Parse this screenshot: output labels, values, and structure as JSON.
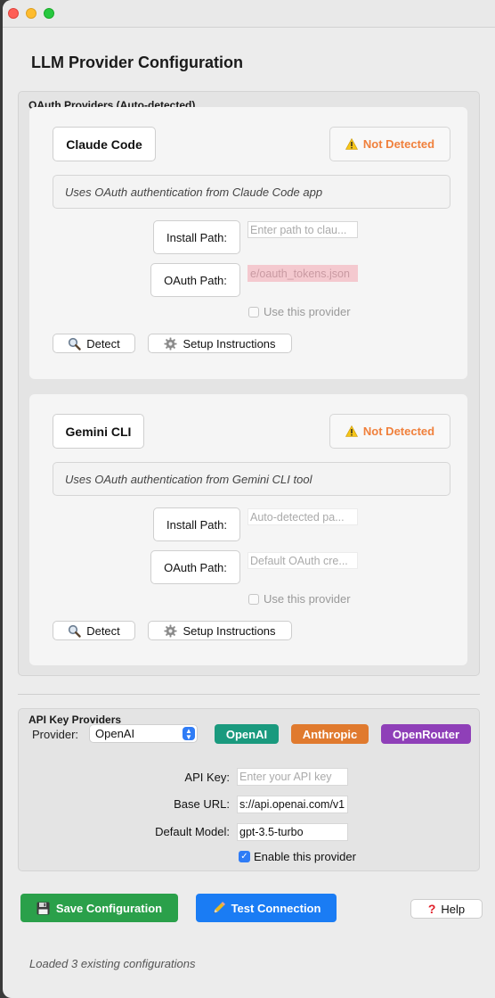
{
  "window": {
    "title": "LLM Provider Configuration"
  },
  "oauth_group": {
    "label": "OAuth Providers (Auto-detected)",
    "providers": [
      {
        "name": "Claude Code",
        "status": "Not Detected",
        "description": "Uses OAuth authentication from Claude Code app",
        "install_label": "Install Path:",
        "install_value": "",
        "install_placeholder": "Enter path to clau...",
        "oauth_label": "OAuth Path:",
        "oauth_value": "e/oauth_tokens.json",
        "use_label": "Use this provider",
        "use_checked": false,
        "detect_label": "Detect",
        "setup_label": "Setup Instructions"
      },
      {
        "name": "Gemini CLI",
        "status": "Not Detected",
        "description": "Uses OAuth authentication from Gemini CLI tool",
        "install_label": "Install Path:",
        "install_placeholder": "Auto-detected pa...",
        "oauth_label": "OAuth Path:",
        "oauth_placeholder": "Default OAuth cre...",
        "use_label": "Use this provider",
        "use_checked": false,
        "detect_label": "Detect",
        "setup_label": "Setup Instructions"
      }
    ]
  },
  "api_group": {
    "label": "API Key Providers",
    "provider_label": "Provider:",
    "provider_selected": "OpenAI",
    "quick_buttons": [
      {
        "label": "OpenAI",
        "color": "#1a9a7e"
      },
      {
        "label": "Anthropic",
        "color": "#e07a2e"
      },
      {
        "label": "OpenRouter",
        "color": "#8f3fb8"
      }
    ],
    "api_key_label": "API Key:",
    "api_key_placeholder": "Enter your API key",
    "base_url_label": "Base URL:",
    "base_url_value": "s://api.openai.com/v1",
    "model_label": "Default Model:",
    "model_value": "gpt-3.5-turbo",
    "enable_label": "Enable this provider",
    "enable_checked": true
  },
  "footer": {
    "save_label": "Save Configuration",
    "save_color": "#2aa04a",
    "test_label": "Test Connection",
    "test_color": "#1a7cf4",
    "help_label": "Help",
    "status_text": "Loaded 3 existing configurations"
  },
  "colors": {
    "warning": "#f0803c",
    "checkbox_accent": "#2f7cf6"
  }
}
